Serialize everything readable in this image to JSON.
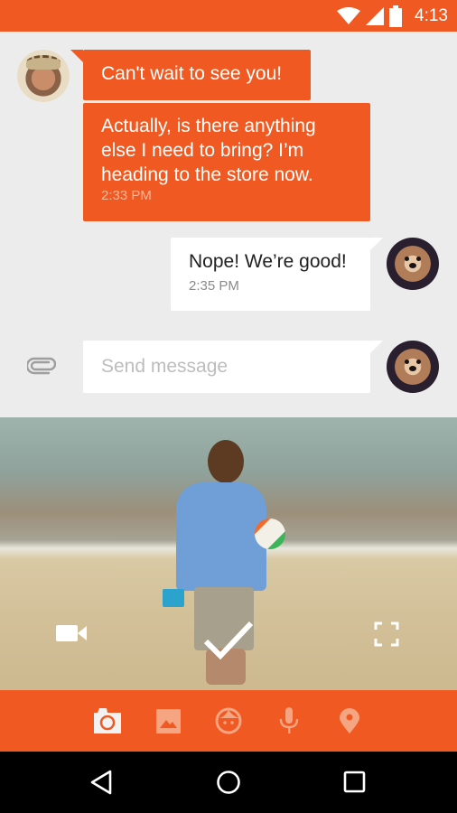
{
  "status_bar": {
    "time": "4:13",
    "icons": [
      "wifi-icon",
      "cell-signal-icon",
      "battery-icon"
    ]
  },
  "conversation": {
    "messages": [
      {
        "sender": "contact",
        "avatar": "man-avatar",
        "text": "Can't wait to see you!",
        "timestamp": ""
      },
      {
        "sender": "contact",
        "avatar": "",
        "text": "Actually, is there anything else I need to bring? I’m heading to the store now.",
        "timestamp": "2:33 PM"
      },
      {
        "sender": "me",
        "avatar": "dog-avatar",
        "text": "Nope! We’re good!",
        "timestamp": "2:35 PM"
      }
    ]
  },
  "compose": {
    "attach_icon": "paperclip-icon",
    "placeholder": "Send message",
    "value": ""
  },
  "camera": {
    "controls": [
      "video-camera-icon",
      "checkmark-icon",
      "fullscreen-icon"
    ]
  },
  "toolbar": {
    "items": [
      {
        "name": "camera",
        "icon": "camera-icon",
        "active": true
      },
      {
        "name": "gallery",
        "icon": "image-icon",
        "active": false
      },
      {
        "name": "stickers",
        "icon": "face-icon",
        "active": false
      },
      {
        "name": "audio",
        "icon": "microphone-icon",
        "active": false
      },
      {
        "name": "location",
        "icon": "location-pin-icon",
        "active": false
      }
    ]
  },
  "navigation": {
    "buttons": [
      "back",
      "home",
      "recents"
    ]
  },
  "colors": {
    "accent": "#f05a22",
    "background": "#ececec",
    "bubble_out": "#ffffff",
    "toolbar_inactive_icon": "#f6a583",
    "toolbar_active_icon": "#f2f2f2"
  }
}
